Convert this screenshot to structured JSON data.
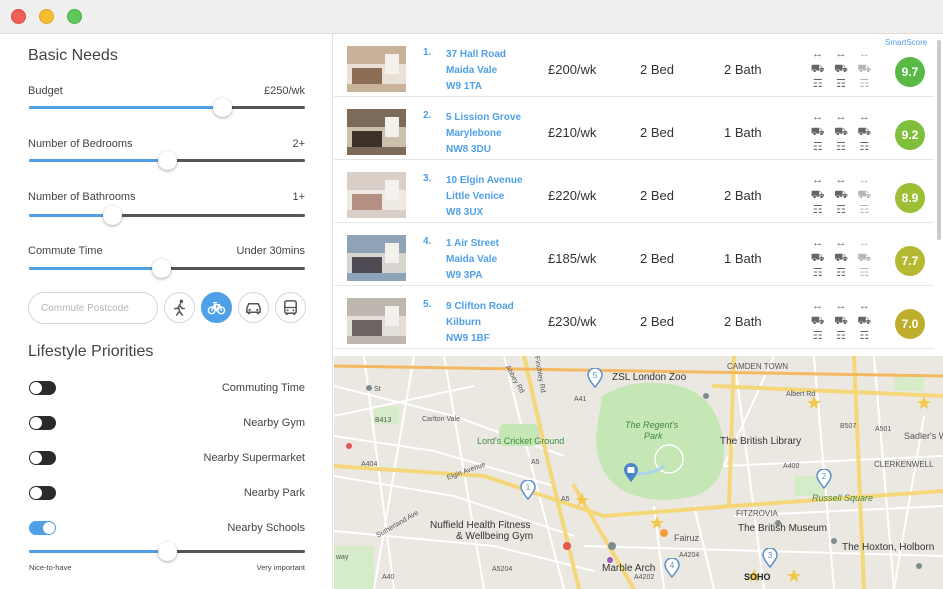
{
  "sidebar": {
    "basic_title": "Basic Needs",
    "budget": {
      "label": "Budget",
      "value": "£250/wk",
      "level": 0.7
    },
    "bedrooms": {
      "label": "Number of Bedrooms",
      "value": "2+",
      "level": 0.5
    },
    "bathrooms": {
      "label": "Number of Bathrooms",
      "value": "1+",
      "level": 0.3
    },
    "commute": {
      "label": "Commute Time",
      "value": "Under 30mins",
      "level": 0.48
    },
    "postcode_placeholder": "Commute Postcode",
    "modes": [
      {
        "name": "walk-icon",
        "active": false
      },
      {
        "name": "bike-icon",
        "active": true
      },
      {
        "name": "car-icon",
        "active": false
      },
      {
        "name": "bus-icon",
        "active": false
      }
    ],
    "lifestyle_title": "Lifestyle Priorities",
    "priorities": [
      {
        "label": "Commuting Time",
        "on": false
      },
      {
        "label": "Nearby Gym",
        "on": false
      },
      {
        "label": "Nearby Supermarket",
        "on": false
      },
      {
        "label": "Nearby Park",
        "on": false
      },
      {
        "label": "Nearby Schools",
        "on": true
      }
    ],
    "importance_level": 0.5,
    "scale_min": "Nice-to-have",
    "scale_max": "Very important"
  },
  "listings": {
    "smartscore_label": "SmartScore",
    "rows": [
      {
        "num": "1.",
        "line1": "37 Hall Road",
        "line2": "Maida Vale",
        "line3": "W9 1TA",
        "price": "£200/wk",
        "beds": "2 Bed",
        "baths": "2 Bath",
        "score": "9.7",
        "color": "#58b947",
        "dim": [
          false,
          false,
          true
        ]
      },
      {
        "num": "2.",
        "line1": "5 Lission Grove",
        "line2": "Marylebone",
        "line3": "NW8 3DU",
        "price": "£210/wk",
        "beds": "2 Bed",
        "baths": "1 Bath",
        "score": "9.2",
        "color": "#7fbf3b",
        "dim": [
          false,
          false,
          false
        ]
      },
      {
        "num": "3.",
        "line1": "10 Elgin Avenue",
        "line2": "Little Venice",
        "line3": "W8 3UX",
        "price": "£220/wk",
        "beds": "2 Bed",
        "baths": "2 Bath",
        "score": "8.9",
        "color": "#9cbf36",
        "dim": [
          false,
          false,
          true
        ]
      },
      {
        "num": "4.",
        "line1": "1 Air Street",
        "line2": "Maida Vale",
        "line3": "W9 3PA",
        "price": "£185/wk",
        "beds": "2 Bed",
        "baths": "1 Bath",
        "score": "7.7",
        "color": "#b5b931",
        "dim": [
          false,
          false,
          true
        ]
      },
      {
        "num": "5.",
        "line1": "9 Clifton Road",
        "line2": "Kilburn",
        "line3": "NW9 1BF",
        "price": "£230/wk",
        "beds": "2 Bed",
        "baths": "2 Bath",
        "score": "7.0",
        "color": "#bfae2d",
        "dim": [
          false,
          false,
          false
        ]
      }
    ]
  },
  "map": {
    "labels": {
      "zoo": "ZSL London Zoo",
      "camden": "CAMDEN TOWN",
      "regents1": "The Regent's",
      "regents2": "Park",
      "lords": "Lord's Cricket Ground",
      "library": "The British Library",
      "sadlers": "Sadler's W",
      "clerkenwell": "CLERKENWELL",
      "russell": "Russell Square",
      "fitzrovia": "FITZROVIA",
      "museum": "The British Museum",
      "nuffield1": "Nuffield Health Fitness",
      "nuffield2": "& Wellbeing Gym",
      "fairuz": "Fairuz",
      "marble": "Marble Arch",
      "soho": "SOHO",
      "hoxton": "The Hoxton, Holborn",
      "carlton": "Carlton Vale",
      "elgin": "Elgin Avenue",
      "b413": "B413",
      "a404": "A404",
      "a5": "A5",
      "a501": "A501",
      "b507": "B507",
      "a41": "A41",
      "a4204": "A4204",
      "a4202": "A4202",
      "a400": "A400",
      "finchley": "Finchley Rd",
      "abbey": "Abbey Rd",
      "st": "St",
      "albert": "Albert Rd",
      "way": "way",
      "sutherland": "Sutherland Ave",
      "a5204": "A5204",
      "a40": "A40"
    },
    "pins": [
      {
        "label": "5"
      },
      {
        "label": "1"
      },
      {
        "label": "2"
      },
      {
        "label": "3"
      },
      {
        "label": "4"
      }
    ]
  }
}
